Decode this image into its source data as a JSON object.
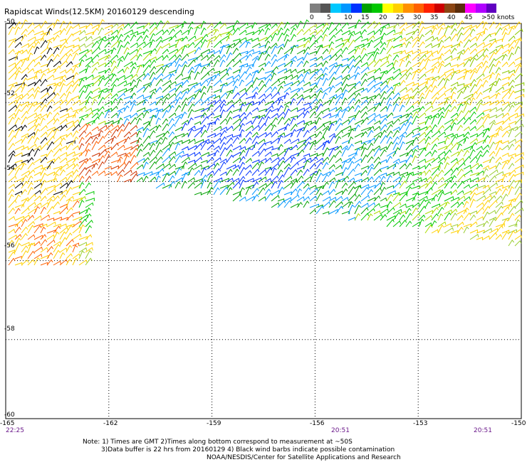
{
  "title": "Rapidscat Winds(12.5KM) 20160129 descending",
  "legend": {
    "colors": [
      "#7f7f7f",
      "#555555",
      "#00c8ff",
      "#0096ff",
      "#0032ff",
      "#00a000",
      "#00c800",
      "#ffff00",
      "#ffd000",
      "#ff9000",
      "#ff6000",
      "#ff2000",
      "#cc0000",
      "#8b4513",
      "#5a2d0c",
      "#ff00ff",
      "#b000ff",
      "#6000c0"
    ],
    "labels": [
      {
        "text": "0"
      },
      {
        "text": "5"
      },
      {
        "text": "10"
      },
      {
        "text": "15"
      },
      {
        "text": "20"
      },
      {
        "text": "25"
      },
      {
        "text": "30"
      },
      {
        "text": "35"
      },
      {
        "text": "40"
      },
      {
        "text": "45"
      },
      {
        "text": ">50 knots"
      }
    ]
  },
  "lat_labels": [
    "-50",
    "-52",
    "-54",
    "-56",
    "-58",
    "-60"
  ],
  "lon_labels": [
    "-165",
    "-162",
    "-159",
    "-156",
    "-153",
    "-150"
  ],
  "time_labels": [
    "22:25",
    "20:51",
    "20:51"
  ],
  "notes": [
    "Note: 1) Times are GMT 2)Times along bottom correspond to measurement at ~50S",
    "3)Data buffer is 22 hrs from 20160129 4) Black wind barbs indicate possible contamination",
    "NOAA/NESDIS/Center for Satellite Applications and Research"
  ],
  "map_data": {
    "lon_range": [
      -165,
      -150
    ],
    "lat_range": [
      -60,
      -50
    ],
    "grid": true,
    "speed_units": "knots"
  }
}
